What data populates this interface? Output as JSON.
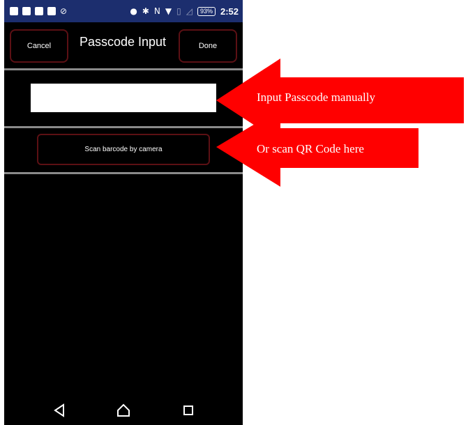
{
  "status_bar": {
    "battery": "93%",
    "time": "2:52"
  },
  "header": {
    "title": "Passcode Input",
    "cancel_label": "Cancel",
    "done_label": "Done"
  },
  "passcode_input": {
    "value": "",
    "placeholder": ""
  },
  "scan_button_label": "Scan barcode by camera",
  "annotations": {
    "arrow_1_text": "Input Passcode manually",
    "arrow_2_text": "Or scan QR Code here",
    "arrow_color": "#ff0000"
  },
  "nav_bar": {
    "icons": [
      "back-icon",
      "home-icon",
      "recent-apps-icon"
    ]
  },
  "colors": {
    "status_bar": "#1c2e6e",
    "button_border": "#5c1014",
    "background": "#000000"
  }
}
